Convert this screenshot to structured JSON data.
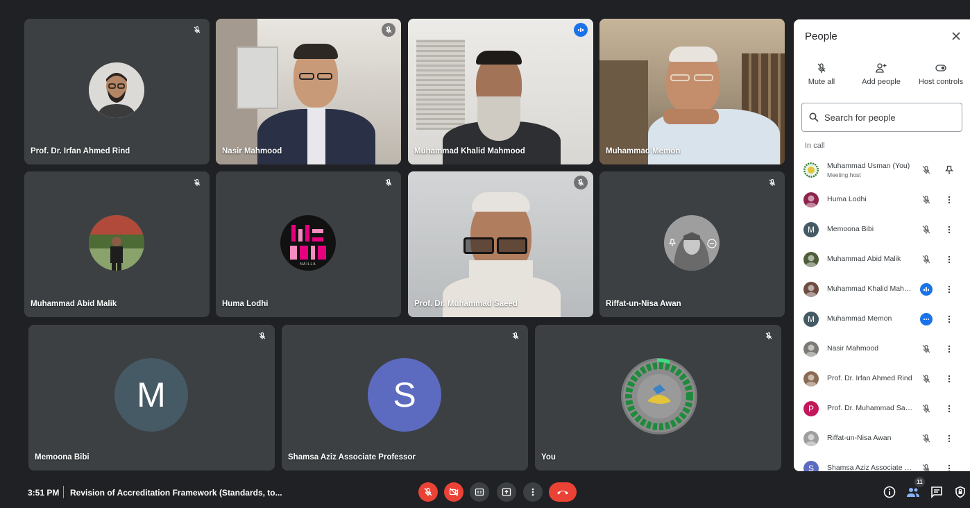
{
  "tiles": {
    "rind": {
      "name": "Prof. Dr. Irfan Ahmed Rind"
    },
    "nasir": {
      "name": "Nasir Mahmood"
    },
    "khalid": {
      "name": "Muhammad Khalid Mahmood"
    },
    "memon": {
      "name": "Muhammad Memon"
    },
    "abid": {
      "name": "Muhammad Abid Malik"
    },
    "huma": {
      "name": "Huma Lodhi"
    },
    "saeed": {
      "name": "Prof. Dr. Muhammad Saeed"
    },
    "riffat": {
      "name": "Riffat-un-Nisa Awan"
    },
    "memoona": {
      "name": "Memoona Bibi",
      "initial": "M",
      "color": "#455a64"
    },
    "shamsa": {
      "name": "Shamsa Aziz Associate Professor",
      "initial": "S",
      "color": "#5c6bc0"
    },
    "you": {
      "name": "You"
    }
  },
  "logo_text": "NAILLA",
  "panel": {
    "title": "People",
    "actions": {
      "mute_all": "Mute all",
      "add_people": "Add people",
      "host_controls": "Host controls"
    },
    "search_placeholder": "Search for people",
    "section": "In call",
    "host_name": "Muhammad Usman (You)",
    "host_sub": "Meeting host",
    "people": [
      {
        "name": "Huma Lodhi",
        "status": "muted",
        "avatar": "photo",
        "color": "#8e244d"
      },
      {
        "name": "Memoona Bibi",
        "status": "muted",
        "avatar": "letter",
        "initial": "M",
        "color": "#455a64"
      },
      {
        "name": "Muhammad Abid Malik",
        "status": "muted",
        "avatar": "photo",
        "color": "#4e5d3a"
      },
      {
        "name": "Muhammad Khalid Mahm...",
        "status": "speaking",
        "avatar": "photo",
        "color": "#6d4c41"
      },
      {
        "name": "Muhammad Memon",
        "status": "dots",
        "avatar": "letter",
        "initial": "M",
        "color": "#455a64"
      },
      {
        "name": "Nasir Mahmood",
        "status": "muted",
        "avatar": "photo",
        "color": "#7d7a76"
      },
      {
        "name": "Prof. Dr. Irfan Ahmed Rind",
        "status": "muted",
        "avatar": "photo",
        "color": "#8a6a52"
      },
      {
        "name": "Prof. Dr. Muhammad Saeed",
        "status": "muted",
        "avatar": "letter",
        "initial": "P",
        "color": "#c2185b"
      },
      {
        "name": "Riffat-un-Nisa Awan",
        "status": "muted",
        "avatar": "photo",
        "color": "#9e9e9e"
      },
      {
        "name": "Shamsa Aziz Associate Pr...",
        "status": "muted",
        "avatar": "letter",
        "initial": "S",
        "color": "#5c6bc0"
      }
    ]
  },
  "bottom": {
    "time": "3:51 PM",
    "meeting_title": "Revision of Accreditation Framework (Standards, to...",
    "participant_count": "11"
  },
  "colors": {
    "accent": "#1a73e8",
    "danger": "#ea4335",
    "tile": "#3c4043",
    "background": "#202124"
  }
}
